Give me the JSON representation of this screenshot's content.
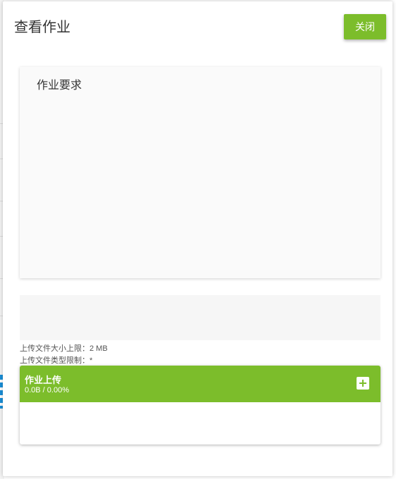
{
  "modal": {
    "title": "查看作业",
    "close_label": "关闭"
  },
  "requirements": {
    "title": "作业要求"
  },
  "upload": {
    "size_limit": "上传文件大小上限：2 MB",
    "type_limit": "上传文件类型限制：*",
    "panel_title": "作业上传",
    "progress": "0.0B / 0.00%",
    "add_icon": "plus-icon"
  },
  "colors": {
    "accent": "#7cbd2b",
    "background_link": "#1a8fd8"
  }
}
